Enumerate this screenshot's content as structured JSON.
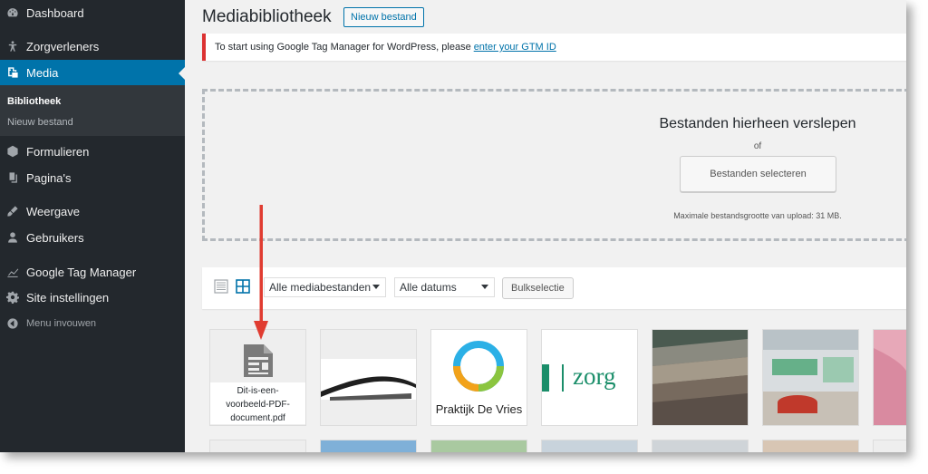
{
  "sidebar": {
    "items": [
      {
        "label": "Dashboard",
        "icon": "dashboard-icon"
      },
      {
        "label": "Zorgverleners",
        "icon": "person-icon"
      },
      {
        "label": "Media",
        "icon": "media-icon"
      },
      {
        "label": "Formulieren",
        "icon": "forms-icon"
      },
      {
        "label": "Pagina's",
        "icon": "pages-icon"
      },
      {
        "label": "Weergave",
        "icon": "appearance-icon"
      },
      {
        "label": "Gebruikers",
        "icon": "users-icon"
      },
      {
        "label": "Google Tag Manager",
        "icon": "chart-icon"
      },
      {
        "label": "Site instellingen",
        "icon": "gear-icon"
      },
      {
        "label": "Menu invouwen",
        "icon": "collapse-icon"
      }
    ],
    "submenu": [
      {
        "label": "Bibliotheek"
      },
      {
        "label": "Nieuw bestand"
      }
    ]
  },
  "header": {
    "title": "Mediabibliotheek",
    "add_new_label": "Nieuw bestand"
  },
  "notice": {
    "text": "To start using Google Tag Manager for WordPress, please",
    "link": "enter your GTM ID"
  },
  "uploader": {
    "title": "Bestanden hierheen verslepen",
    "or": "of",
    "select_label": "Bestanden selecteren",
    "max_size": "Maximale bestandsgrootte van upload: 31 MB."
  },
  "toolbar": {
    "type_filter": "Alle mediabestanden",
    "date_filter": "Alle datums",
    "bulk_label": "Bulkselectie"
  },
  "media": {
    "pdf": {
      "line1": "Dit-is-een-",
      "line2": "voorbeeld-PDF-",
      "line3": "document.pdf"
    },
    "logo1_text": "Praktijk De Vries",
    "logo2_text": "zorg"
  },
  "colors": {
    "sidebar_bg": "#23282d",
    "active_bg": "#0073aa",
    "notice_border": "#dc3232",
    "annotation_arrow": "#e03c31"
  }
}
